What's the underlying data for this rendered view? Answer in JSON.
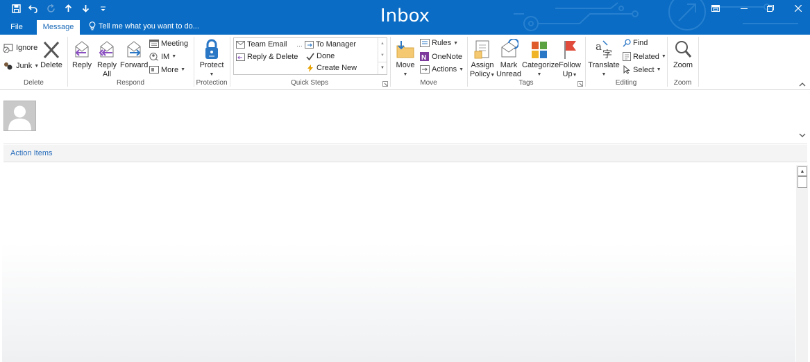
{
  "window": {
    "title": "Inbox",
    "qat_icons": [
      "save-icon",
      "undo-icon",
      "redo-icon",
      "up-arrow-icon",
      "down-arrow-icon",
      "customize-qat-icon"
    ],
    "controls": [
      "ribbon-display-icon",
      "minimize-icon",
      "restore-icon",
      "close-icon"
    ]
  },
  "tabs": {
    "file": "File",
    "message": "Message"
  },
  "tellme": {
    "text": "Tell me what you want to do..."
  },
  "ribbon": {
    "delete": {
      "label": "Delete",
      "ignore": "Ignore",
      "junk": "Junk",
      "delete": "Delete"
    },
    "respond": {
      "label": "Respond",
      "reply": "Reply",
      "reply_all_1": "Reply",
      "reply_all_2": "All",
      "forward": "Forward",
      "meeting": "Meeting",
      "im": "IM",
      "more": "More"
    },
    "protection": {
      "label": "Protection",
      "protect": "Protect"
    },
    "quicksteps": {
      "label": "Quick Steps",
      "team_email": "Team Email",
      "reply_delete": "Reply & Delete",
      "to_manager": "To Manager",
      "done": "Done",
      "create_new": "Create New"
    },
    "move": {
      "label": "Move",
      "move": "Move",
      "rules": "Rules",
      "onenote": "OneNote",
      "actions": "Actions"
    },
    "tags": {
      "label": "Tags",
      "assign_1": "Assign",
      "assign_2": "Policy",
      "mark_1": "Mark",
      "mark_2": "Unread",
      "categorize": "Categorize",
      "follow_1": "Follow",
      "follow_2": "Up"
    },
    "editing": {
      "label": "Editing",
      "translate": "Translate",
      "find": "Find",
      "related": "Related",
      "select": "Select"
    },
    "zoom": {
      "label": "Zoom",
      "zoom": "Zoom"
    }
  },
  "message": {
    "action_items": "Action Items"
  },
  "colors": {
    "titlebar": "#0a6cc4",
    "accent": "#1d6bb8"
  }
}
